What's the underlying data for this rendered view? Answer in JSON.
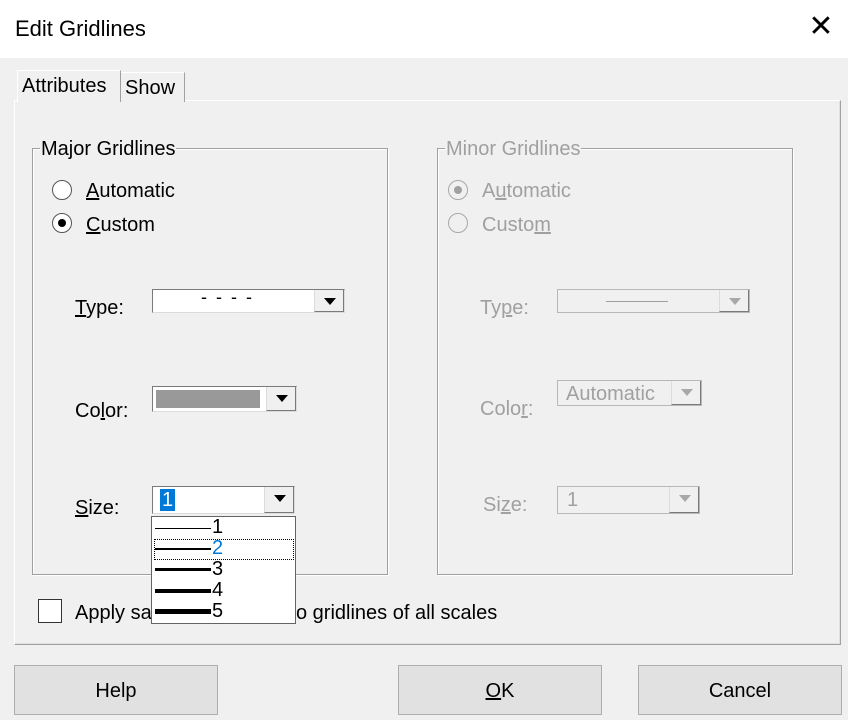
{
  "window": {
    "title": "Edit Gridlines",
    "close_glyph": "✕"
  },
  "tabs": [
    {
      "label": "Attributes",
      "active": true
    },
    {
      "label": "Show",
      "active": false
    }
  ],
  "major": {
    "title": "Major Gridlines",
    "radio_automatic": "Automatic",
    "radio_custom": "Custom",
    "selected": "Custom",
    "type_label": "Type:",
    "type_value": "- - - -",
    "color_label": "Color:",
    "color_value": "#999999",
    "size_label": "Size:",
    "size_value": "1",
    "size_options": [
      "1",
      "2",
      "3",
      "4",
      "5"
    ],
    "size_focused_option": "2"
  },
  "minor": {
    "title": "Minor Gridlines",
    "radio_automatic": "Automatic",
    "radio_custom": "Custom",
    "selected": "Automatic",
    "disabled": true,
    "type_label": "Type:",
    "color_label": "Color:",
    "color_value": "Automatic",
    "size_label": "Size:",
    "size_value": "1"
  },
  "apply_all": {
    "label_visible_left": "Apply sa",
    "label_visible_right": "o gridlines of all scales",
    "checked": false
  },
  "buttons": {
    "help": "Help",
    "ok": "OK",
    "cancel": "Cancel"
  },
  "colors": {
    "selection": "#0078d7",
    "disabled_text": "#a0a0a0",
    "swatch": "#999999"
  }
}
